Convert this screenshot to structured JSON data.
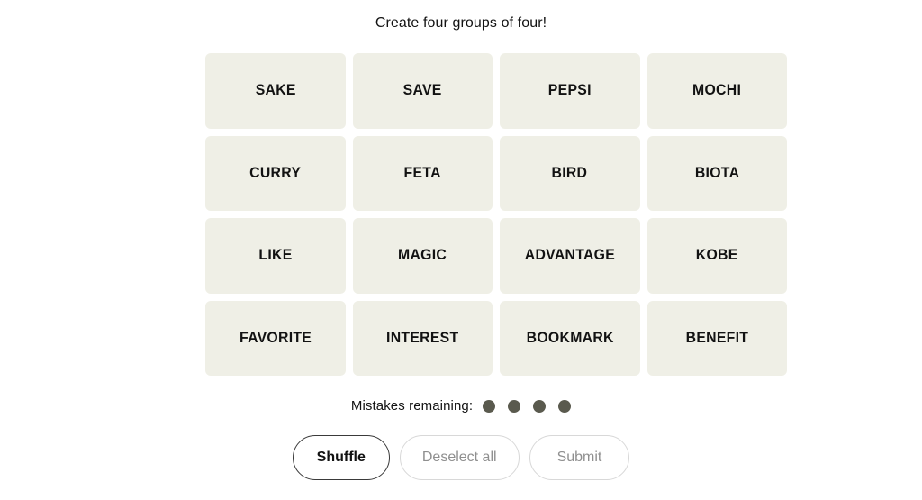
{
  "game": {
    "title": "Create four groups of four!"
  },
  "board": {
    "tiles": [
      {
        "label": "SAKE",
        "selected": false
      },
      {
        "label": "SAVE",
        "selected": false
      },
      {
        "label": "PEPSI",
        "selected": false
      },
      {
        "label": "MOCHI",
        "selected": false
      },
      {
        "label": "CURRY",
        "selected": false
      },
      {
        "label": "FETA",
        "selected": false
      },
      {
        "label": "BIRD",
        "selected": false
      },
      {
        "label": "BIOTA",
        "selected": false
      },
      {
        "label": "LIKE",
        "selected": false
      },
      {
        "label": "MAGIC",
        "selected": false
      },
      {
        "label": "ADVANTAGE",
        "selected": false
      },
      {
        "label": "KOBE",
        "selected": false
      },
      {
        "label": "FAVORITE",
        "selected": false
      },
      {
        "label": "INTEREST",
        "selected": false
      },
      {
        "label": "BOOKMARK",
        "selected": false
      },
      {
        "label": "BENEFIT",
        "selected": false
      }
    ],
    "tile_color": "#efefe6",
    "tile_text_color": "#121212"
  },
  "mistakes": {
    "label": "Mistakes remaining:",
    "remaining": 4,
    "dots": [
      "dot",
      "dot",
      "dot",
      "dot"
    ],
    "dot_color": "#5a5a4e"
  },
  "controls": {
    "shuffle_label": "Shuffle",
    "deselect_label": "Deselect all",
    "submit_label": "Submit",
    "shuffle_enabled": true,
    "deselect_enabled": false,
    "submit_enabled": false,
    "active_border_color": "#3a3a3a",
    "disabled_border_color": "#d8d8d8",
    "disabled_text_color": "#8f8f8f"
  }
}
